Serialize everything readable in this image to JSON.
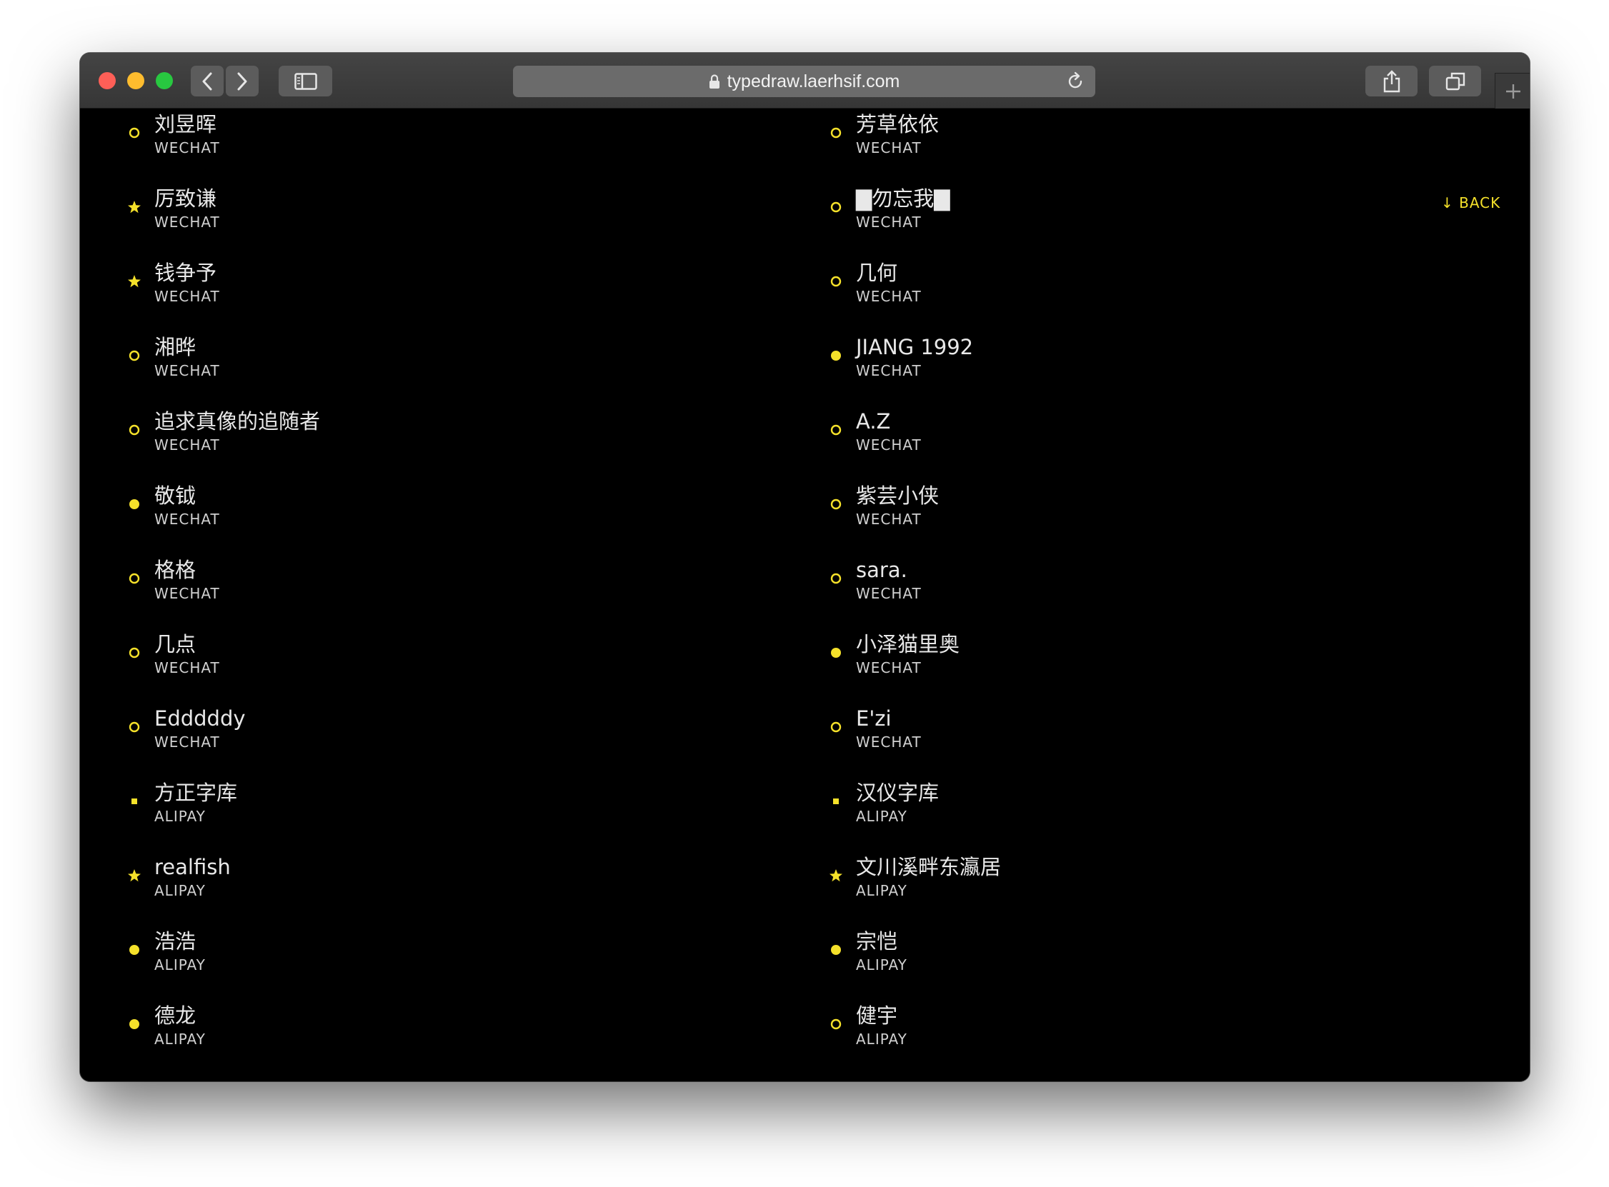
{
  "browser": {
    "url": "typedraw.laerhsif.com",
    "traffic_lights": {
      "close": "#fe5f57",
      "minimize": "#febc2e",
      "zoom": "#28c840"
    }
  },
  "page": {
    "back_label": "↓ BACK",
    "accent_color": "#f5e12a",
    "left_column": [
      {
        "name": "刘昱晖",
        "platform": "WECHAT",
        "marker": "ring"
      },
      {
        "name": "厉致谦",
        "platform": "WECHAT",
        "marker": "star"
      },
      {
        "name": "钱争予",
        "platform": "WECHAT",
        "marker": "star"
      },
      {
        "name": "湘晔",
        "platform": "WECHAT",
        "marker": "ring"
      },
      {
        "name": "追求真像的追随者",
        "platform": "WECHAT",
        "marker": "ring"
      },
      {
        "name": "敬钺",
        "platform": "WECHAT",
        "marker": "dot"
      },
      {
        "name": "格格",
        "platform": "WECHAT",
        "marker": "ring"
      },
      {
        "name": "几点",
        "platform": "WECHAT",
        "marker": "ring"
      },
      {
        "name": "Edddddy",
        "platform": "WECHAT",
        "marker": "ring"
      },
      {
        "name": "方正字库",
        "platform": "ALIPAY",
        "marker": "square"
      },
      {
        "name": "realfish",
        "platform": "ALIPAY",
        "marker": "star"
      },
      {
        "name": "浩浩",
        "platform": "ALIPAY",
        "marker": "dot"
      },
      {
        "name": "德龙",
        "platform": "ALIPAY",
        "marker": "dot"
      }
    ],
    "right_column": [
      {
        "name": "芳草依依",
        "platform": "WECHAT",
        "marker": "ring"
      },
      {
        "name": "▇勿忘我▇",
        "platform": "WECHAT",
        "marker": "ring"
      },
      {
        "name": "几何",
        "platform": "WECHAT",
        "marker": "ring"
      },
      {
        "name": "JIANG 1992",
        "platform": "WECHAT",
        "marker": "dot"
      },
      {
        "name": "A.Z",
        "platform": "WECHAT",
        "marker": "ring"
      },
      {
        "name": "紫芸小侠",
        "platform": "WECHAT",
        "marker": "ring"
      },
      {
        "name": "sara.",
        "platform": "WECHAT",
        "marker": "ring"
      },
      {
        "name": "小泽猫里奥",
        "platform": "WECHAT",
        "marker": "dot"
      },
      {
        "name": "E'zi",
        "platform": "WECHAT",
        "marker": "ring"
      },
      {
        "name": "汉仪字库",
        "platform": "ALIPAY",
        "marker": "square"
      },
      {
        "name": "文川溪畔东瀛居",
        "platform": "ALIPAY",
        "marker": "star"
      },
      {
        "name": "宗恺",
        "platform": "ALIPAY",
        "marker": "dot"
      },
      {
        "name": "健宇",
        "platform": "ALIPAY",
        "marker": "ring"
      }
    ]
  }
}
